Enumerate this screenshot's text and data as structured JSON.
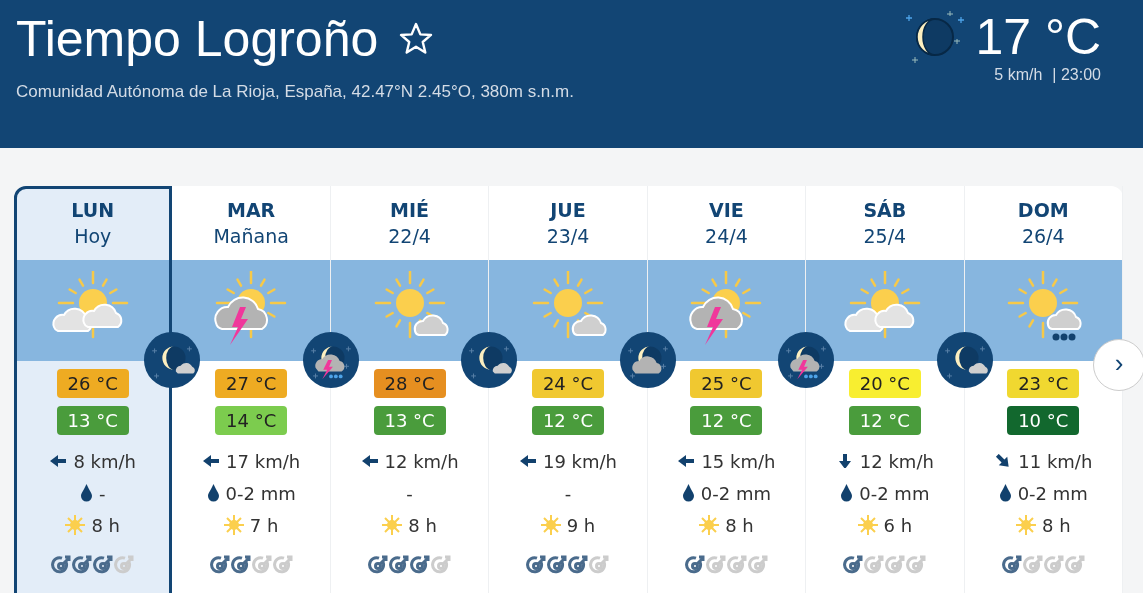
{
  "header": {
    "title": "Tiempo Logroño",
    "favorite": false,
    "subtitle": "Comunidad Autónoma de La Rioja, España, 42.47°N 2.45°O, 380m s.n.m.",
    "now": {
      "temp": "17 °C",
      "wind": "5 km/h",
      "time": "| 23:00"
    }
  },
  "days": [
    {
      "day": "LUN",
      "date": "Hoy",
      "selected": true,
      "kind": "sun_clouds",
      "max": {
        "text": "26 °C",
        "color": "#eeab22"
      },
      "min": {
        "text": "13 °C",
        "color": "#4a9c3c"
      },
      "wind": {
        "kind": "left",
        "text": "8 km/h"
      },
      "rain": {
        "drop": true,
        "text": "-"
      },
      "sun": "8 h",
      "stars": 3
    },
    {
      "day": "MAR",
      "date": "Mañana",
      "selected": false,
      "kind": "storm",
      "max": {
        "text": "27 °C",
        "color": "#eeab22"
      },
      "min": {
        "text": "14 °C",
        "color": "#7ccc4e"
      },
      "wind": {
        "kind": "left",
        "text": "17 km/h"
      },
      "rain": {
        "drop": true,
        "text": "0-2 mm"
      },
      "sun": "7 h",
      "stars": 2
    },
    {
      "day": "MIÉ",
      "date": "22/4",
      "selected": false,
      "kind": "sun_cloud",
      "max": {
        "text": "28 °C",
        "color": "#e68f20"
      },
      "min": {
        "text": "13 °C",
        "color": "#4a9c3c"
      },
      "wind": {
        "kind": "left",
        "text": "12 km/h"
      },
      "rain": {
        "drop": false,
        "text": "-"
      },
      "sun": "8 h",
      "stars": 3
    },
    {
      "day": "JUE",
      "date": "23/4",
      "selected": false,
      "kind": "sun_cloud",
      "max": {
        "text": "24 °C",
        "color": "#f0c830"
      },
      "min": {
        "text": "12 °C",
        "color": "#4a9c3c"
      },
      "wind": {
        "kind": "left",
        "text": "19 km/h"
      },
      "rain": {
        "drop": false,
        "text": "-"
      },
      "sun": "9 h",
      "stars": 3
    },
    {
      "day": "VIE",
      "date": "24/4",
      "selected": false,
      "kind": "storm",
      "max": {
        "text": "25 °C",
        "color": "#f0c830"
      },
      "min": {
        "text": "12 °C",
        "color": "#4a9c3c"
      },
      "wind": {
        "kind": "left",
        "text": "15 km/h"
      },
      "rain": {
        "drop": true,
        "text": "0-2 mm"
      },
      "sun": "8 h",
      "stars": 1
    },
    {
      "day": "SÁB",
      "date": "25/4",
      "selected": false,
      "kind": "sun_clouds",
      "max": {
        "text": "20 °C",
        "color": "#f8ee30"
      },
      "min": {
        "text": "12 °C",
        "color": "#4a9c3c"
      },
      "wind": {
        "kind": "down",
        "text": "12 km/h"
      },
      "rain": {
        "drop": true,
        "text": "0-2 mm"
      },
      "sun": "6 h",
      "stars": 1
    },
    {
      "day": "DOM",
      "date": "26/4",
      "selected": false,
      "kind": "sun_rain",
      "max": {
        "text": "23 °C",
        "color": "#f0d830"
      },
      "min": {
        "text": "10 °C",
        "color": "#12682e"
      },
      "wind": {
        "kind": "down_right",
        "text": "11 km/h"
      },
      "rain": {
        "drop": true,
        "text": "0-2 mm"
      },
      "sun": "8 h",
      "stars": 1
    }
  ],
  "nights": [
    {
      "kind": "moon_cloud"
    },
    {
      "kind": "moon_storm"
    },
    {
      "kind": "moon_cloud"
    },
    {
      "kind": "cloud_moon"
    },
    {
      "kind": "moon_storm"
    },
    {
      "kind": "moon_cloud"
    }
  ],
  "next_button": "›"
}
